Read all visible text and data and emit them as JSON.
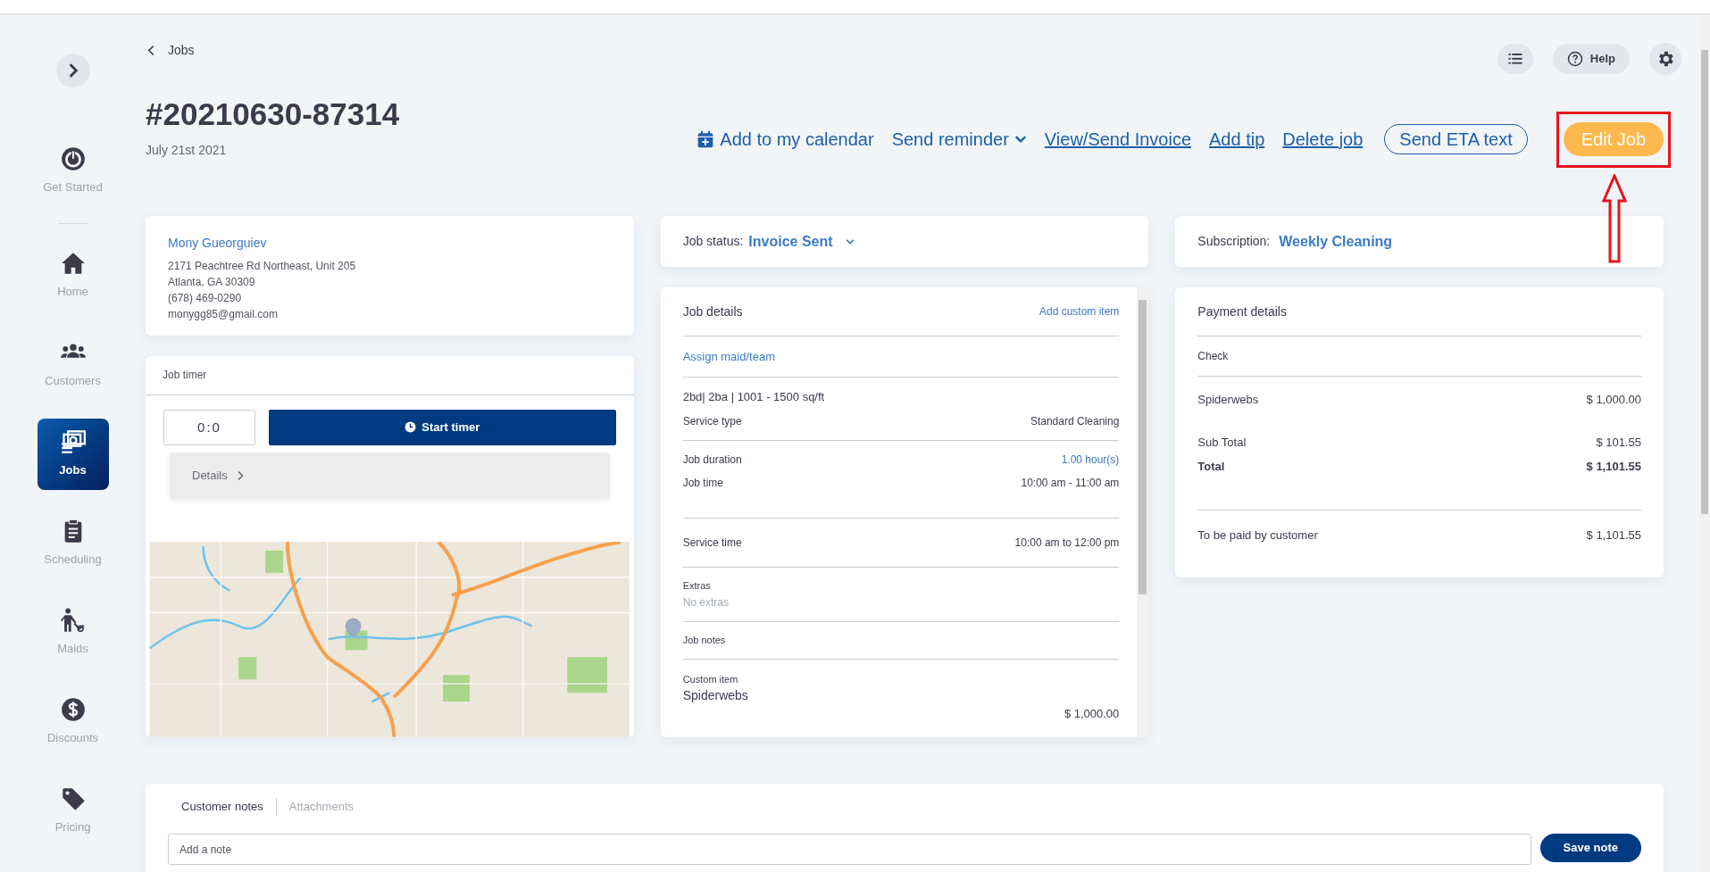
{
  "sidebar": {
    "top_item": {
      "kind": "power",
      "label": "Get Started",
      "selected": false
    },
    "items": [
      {
        "kind": "home",
        "label": "Home",
        "selected": false
      },
      {
        "kind": "customers",
        "label": "Customers",
        "selected": false
      },
      {
        "kind": "jobs",
        "label": "Jobs",
        "selected": true
      },
      {
        "kind": "scheduling",
        "label": "Scheduling",
        "selected": false
      },
      {
        "kind": "maids",
        "label": "Maids",
        "selected": false
      },
      {
        "kind": "discounts",
        "label": "Discounts",
        "selected": false
      },
      {
        "kind": "pricing",
        "label": "Pricing",
        "selected": false
      }
    ]
  },
  "header": {
    "back": "Jobs",
    "help": "Help"
  },
  "job": {
    "number": "#20210630-87314",
    "date": "July 21st 2021"
  },
  "actions": [
    {
      "kind": "calendar",
      "label": "Add to my calendar"
    },
    {
      "kind": "dropdown",
      "label": "Send reminder"
    },
    {
      "kind": "link",
      "label": "View/Send Invoice"
    },
    {
      "kind": "link",
      "label": "Add tip"
    },
    {
      "kind": "link",
      "label": "Delete job"
    },
    {
      "kind": "outline",
      "label": "Send ETA text"
    },
    {
      "kind": "primary",
      "label": "Edit Job",
      "highlighted": true
    }
  ],
  "customer": {
    "name": "Mony Gueorguiev",
    "lines": [
      "2171 Peachtree Rd Northeast, Unit 205",
      "Atlanta, GA 30309",
      "(678) 469-0290",
      "monygg85@gmail.com"
    ]
  },
  "job_timer": {
    "title": "Job timer",
    "time": "0:0",
    "button": "Start timer",
    "details": "Details"
  },
  "job_status": {
    "label": "Job status:",
    "value": "Invoice Sent"
  },
  "job_details": {
    "title": "Job details",
    "action": "Add custom item",
    "sections": [
      {
        "kind": "link",
        "text": "Assign maid/team"
      },
      {
        "kind": "pairs",
        "title": "2bd| 2ba | 1001 - 1500 sq/ft",
        "rows": [
          {
            "label": "Service type",
            "value": "Standard Cleaning",
            "highlight": false
          }
        ]
      },
      {
        "kind": "pairs",
        "rows": [
          {
            "label": "Job duration",
            "value": "1.00 hour(s)",
            "highlight": true
          },
          {
            "label": "Job time",
            "value": "10:00 am - 11:00 am",
            "highlight": false
          }
        ]
      },
      {
        "kind": "pairs",
        "rows": [
          {
            "label": "Service time",
            "value": "10:00 am to 12:00 pm",
            "highlight": false
          }
        ]
      },
      {
        "kind": "note",
        "label": "Extras",
        "value": "No extras"
      },
      {
        "kind": "note",
        "label": "Job notes"
      },
      {
        "kind": "custom",
        "label": "Custom item",
        "name": "Spiderwebs",
        "price": "$ 1,000.00"
      }
    ]
  },
  "subscription": {
    "label": "Subscription:",
    "value": "Weekly Cleaning"
  },
  "payment": {
    "title": "Payment details",
    "method": "Check",
    "items": [
      {
        "label": "Spiderwebs",
        "amount": "$ 1,000.00"
      }
    ],
    "totals": [
      {
        "label": "Sub Total",
        "amount": "$ 101.55",
        "bold": false
      },
      {
        "label": "Total",
        "amount": "$ 1,101.55",
        "bold": true
      }
    ],
    "due": {
      "label": "To be paid by customer",
      "amount": "$ 1,101.55"
    }
  },
  "notes": {
    "tabs": [
      {
        "label": "Customer notes",
        "selected": true
      },
      {
        "label": "Attachments",
        "selected": false
      }
    ],
    "placeholder": "Add a note",
    "button": "Save note"
  }
}
